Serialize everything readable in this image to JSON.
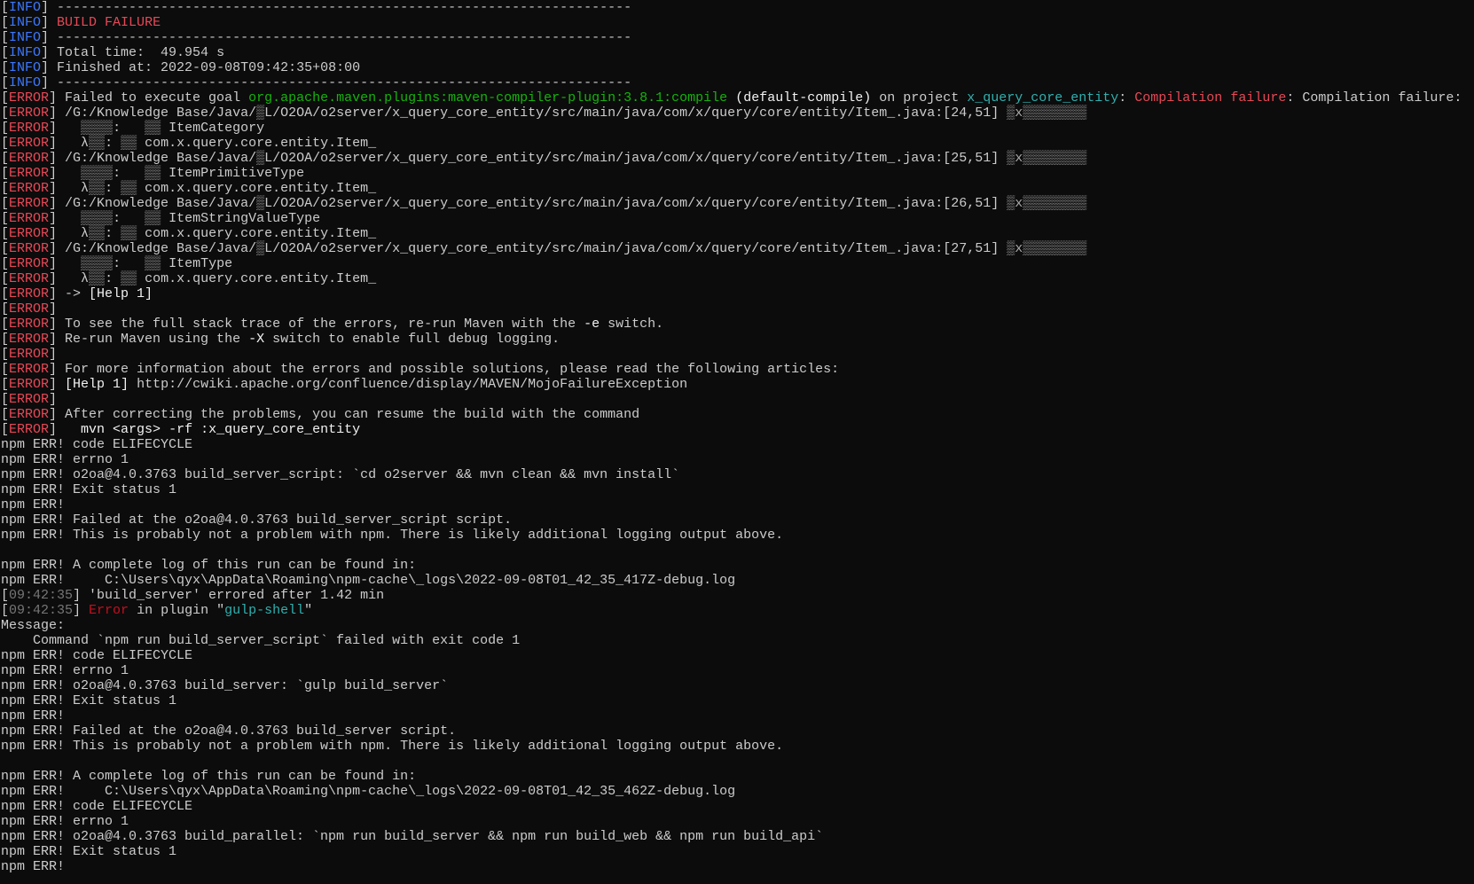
{
  "colors": {
    "background": "#0c0c0c",
    "text": "#cccccc",
    "info": "#3b78ff",
    "error": "#e74856",
    "green": "#16b30c",
    "cyan": "#2fb0b0",
    "timestamp": "#767676"
  },
  "lines": [
    {
      "segments": [
        {
          "t": "[",
          "c": "d"
        },
        {
          "t": "INFO",
          "c": "info"
        },
        {
          "t": "] ------------------------------------------------------------------------",
          "c": "d"
        }
      ]
    },
    {
      "segments": [
        {
          "t": "[",
          "c": "d"
        },
        {
          "t": "INFO",
          "c": "info"
        },
        {
          "t": "] ",
          "c": "d"
        },
        {
          "t": "BUILD FAILURE",
          "c": "red"
        }
      ]
    },
    {
      "segments": [
        {
          "t": "[",
          "c": "d"
        },
        {
          "t": "INFO",
          "c": "info"
        },
        {
          "t": "] ------------------------------------------------------------------------",
          "c": "d"
        }
      ]
    },
    {
      "segments": [
        {
          "t": "[",
          "c": "d"
        },
        {
          "t": "INFO",
          "c": "info"
        },
        {
          "t": "] Total time:  49.954 s",
          "c": "d"
        }
      ]
    },
    {
      "segments": [
        {
          "t": "[",
          "c": "d"
        },
        {
          "t": "INFO",
          "c": "info"
        },
        {
          "t": "] Finished at: 2022-09-08T09:42:35+08:00",
          "c": "d"
        }
      ]
    },
    {
      "segments": [
        {
          "t": "[",
          "c": "d"
        },
        {
          "t": "INFO",
          "c": "info"
        },
        {
          "t": "] ------------------------------------------------------------------------",
          "c": "d"
        }
      ]
    },
    {
      "segments": [
        {
          "t": "[",
          "c": "d"
        },
        {
          "t": "ERROR",
          "c": "err"
        },
        {
          "t": "] Failed to execute goal ",
          "c": "d"
        },
        {
          "t": "org.apache.maven.plugins:maven-compiler-plugin:3.8.1:compile",
          "c": "green"
        },
        {
          "t": " ",
          "c": "d"
        },
        {
          "t": "(default-compile)",
          "c": "white"
        },
        {
          "t": " on project ",
          "c": "d"
        },
        {
          "t": "x_query_core_entity",
          "c": "cyan"
        },
        {
          "t": ": ",
          "c": "d"
        },
        {
          "t": "Compilation failure",
          "c": "red"
        },
        {
          "t": ": Compilation failure:",
          "c": "d"
        }
      ]
    },
    {
      "segments": [
        {
          "t": "[",
          "c": "d"
        },
        {
          "t": "ERROR",
          "c": "err"
        },
        {
          "t": "] /G:/Knowledge Base/Java/",
          "c": "d"
        },
        {
          "t": "▒",
          "c": "garb"
        },
        {
          "t": "L/O2OA/o2server/x_query_core_entity/src/main/java/com/x/query/core/entity/Item_.java:[24,51] ",
          "c": "d"
        },
        {
          "t": "▒x▒▒▒▒▒▒▒▒",
          "c": "garb"
        }
      ]
    },
    {
      "segments": [
        {
          "t": "[",
          "c": "d"
        },
        {
          "t": "ERROR",
          "c": "err"
        },
        {
          "t": "]   ",
          "c": "d"
        },
        {
          "t": "▒▒▒▒",
          "c": "garb"
        },
        {
          "t": ":   ",
          "c": "d"
        },
        {
          "t": "▒▒",
          "c": "garb"
        },
        {
          "t": " ItemCategory",
          "c": "d"
        }
      ]
    },
    {
      "segments": [
        {
          "t": "[",
          "c": "d"
        },
        {
          "t": "ERROR",
          "c": "err"
        },
        {
          "t": "]   λ",
          "c": "d"
        },
        {
          "t": "▒▒",
          "c": "garb"
        },
        {
          "t": ": ",
          "c": "d"
        },
        {
          "t": "▒▒",
          "c": "garb"
        },
        {
          "t": " com.x.query.core.entity.Item_",
          "c": "d"
        }
      ]
    },
    {
      "segments": [
        {
          "t": "[",
          "c": "d"
        },
        {
          "t": "ERROR",
          "c": "err"
        },
        {
          "t": "] /G:/Knowledge Base/Java/",
          "c": "d"
        },
        {
          "t": "▒",
          "c": "garb"
        },
        {
          "t": "L/O2OA/o2server/x_query_core_entity/src/main/java/com/x/query/core/entity/Item_.java:[25,51] ",
          "c": "d"
        },
        {
          "t": "▒x▒▒▒▒▒▒▒▒",
          "c": "garb"
        }
      ]
    },
    {
      "segments": [
        {
          "t": "[",
          "c": "d"
        },
        {
          "t": "ERROR",
          "c": "err"
        },
        {
          "t": "]   ",
          "c": "d"
        },
        {
          "t": "▒▒▒▒",
          "c": "garb"
        },
        {
          "t": ":   ",
          "c": "d"
        },
        {
          "t": "▒▒",
          "c": "garb"
        },
        {
          "t": " ItemPrimitiveType",
          "c": "d"
        }
      ]
    },
    {
      "segments": [
        {
          "t": "[",
          "c": "d"
        },
        {
          "t": "ERROR",
          "c": "err"
        },
        {
          "t": "]   λ",
          "c": "d"
        },
        {
          "t": "▒▒",
          "c": "garb"
        },
        {
          "t": ": ",
          "c": "d"
        },
        {
          "t": "▒▒",
          "c": "garb"
        },
        {
          "t": " com.x.query.core.entity.Item_",
          "c": "d"
        }
      ]
    },
    {
      "segments": [
        {
          "t": "[",
          "c": "d"
        },
        {
          "t": "ERROR",
          "c": "err"
        },
        {
          "t": "] /G:/Knowledge Base/Java/",
          "c": "d"
        },
        {
          "t": "▒",
          "c": "garb"
        },
        {
          "t": "L/O2OA/o2server/x_query_core_entity/src/main/java/com/x/query/core/entity/Item_.java:[26,51] ",
          "c": "d"
        },
        {
          "t": "▒x▒▒▒▒▒▒▒▒",
          "c": "garb"
        }
      ]
    },
    {
      "segments": [
        {
          "t": "[",
          "c": "d"
        },
        {
          "t": "ERROR",
          "c": "err"
        },
        {
          "t": "]   ",
          "c": "d"
        },
        {
          "t": "▒▒▒▒",
          "c": "garb"
        },
        {
          "t": ":   ",
          "c": "d"
        },
        {
          "t": "▒▒",
          "c": "garb"
        },
        {
          "t": " ItemStringValueType",
          "c": "d"
        }
      ]
    },
    {
      "segments": [
        {
          "t": "[",
          "c": "d"
        },
        {
          "t": "ERROR",
          "c": "err"
        },
        {
          "t": "]   λ",
          "c": "d"
        },
        {
          "t": "▒▒",
          "c": "garb"
        },
        {
          "t": ": ",
          "c": "d"
        },
        {
          "t": "▒▒",
          "c": "garb"
        },
        {
          "t": " com.x.query.core.entity.Item_",
          "c": "d"
        }
      ]
    },
    {
      "segments": [
        {
          "t": "[",
          "c": "d"
        },
        {
          "t": "ERROR",
          "c": "err"
        },
        {
          "t": "] /G:/Knowledge Base/Java/",
          "c": "d"
        },
        {
          "t": "▒",
          "c": "garb"
        },
        {
          "t": "L/O2OA/o2server/x_query_core_entity/src/main/java/com/x/query/core/entity/Item_.java:[27,51] ",
          "c": "d"
        },
        {
          "t": "▒x▒▒▒▒▒▒▒▒",
          "c": "garb"
        }
      ]
    },
    {
      "segments": [
        {
          "t": "[",
          "c": "d"
        },
        {
          "t": "ERROR",
          "c": "err"
        },
        {
          "t": "]   ",
          "c": "d"
        },
        {
          "t": "▒▒▒▒",
          "c": "garb"
        },
        {
          "t": ":   ",
          "c": "d"
        },
        {
          "t": "▒▒",
          "c": "garb"
        },
        {
          "t": " ItemType",
          "c": "d"
        }
      ]
    },
    {
      "segments": [
        {
          "t": "[",
          "c": "d"
        },
        {
          "t": "ERROR",
          "c": "err"
        },
        {
          "t": "]   λ",
          "c": "d"
        },
        {
          "t": "▒▒",
          "c": "garb"
        },
        {
          "t": ": ",
          "c": "d"
        },
        {
          "t": "▒▒",
          "c": "garb"
        },
        {
          "t": " com.x.query.core.entity.Item_",
          "c": "d"
        }
      ]
    },
    {
      "segments": [
        {
          "t": "[",
          "c": "d"
        },
        {
          "t": "ERROR",
          "c": "err"
        },
        {
          "t": "] -> ",
          "c": "d"
        },
        {
          "t": "[Help 1]",
          "c": "white"
        }
      ]
    },
    {
      "segments": [
        {
          "t": "[",
          "c": "d"
        },
        {
          "t": "ERROR",
          "c": "err"
        },
        {
          "t": "]",
          "c": "d"
        }
      ]
    },
    {
      "segments": [
        {
          "t": "[",
          "c": "d"
        },
        {
          "t": "ERROR",
          "c": "err"
        },
        {
          "t": "] To see the full stack trace of the errors, re-run Maven with the ",
          "c": "d"
        },
        {
          "t": "-e",
          "c": "white"
        },
        {
          "t": " switch.",
          "c": "d"
        }
      ]
    },
    {
      "segments": [
        {
          "t": "[",
          "c": "d"
        },
        {
          "t": "ERROR",
          "c": "err"
        },
        {
          "t": "] Re-run Maven using the ",
          "c": "d"
        },
        {
          "t": "-X",
          "c": "white"
        },
        {
          "t": " switch to enable full debug logging.",
          "c": "d"
        }
      ]
    },
    {
      "segments": [
        {
          "t": "[",
          "c": "d"
        },
        {
          "t": "ERROR",
          "c": "err"
        },
        {
          "t": "]",
          "c": "d"
        }
      ]
    },
    {
      "segments": [
        {
          "t": "[",
          "c": "d"
        },
        {
          "t": "ERROR",
          "c": "err"
        },
        {
          "t": "] For more information about the errors and possible solutions, please read the following articles:",
          "c": "d"
        }
      ]
    },
    {
      "segments": [
        {
          "t": "[",
          "c": "d"
        },
        {
          "t": "ERROR",
          "c": "err"
        },
        {
          "t": "] ",
          "c": "d"
        },
        {
          "t": "[Help 1]",
          "c": "white"
        },
        {
          "t": " http://cwiki.apache.org/confluence/display/MAVEN/MojoFailureException",
          "c": "d"
        }
      ]
    },
    {
      "segments": [
        {
          "t": "[",
          "c": "d"
        },
        {
          "t": "ERROR",
          "c": "err"
        },
        {
          "t": "]",
          "c": "d"
        }
      ]
    },
    {
      "segments": [
        {
          "t": "[",
          "c": "d"
        },
        {
          "t": "ERROR",
          "c": "err"
        },
        {
          "t": "] After correcting the problems, you can resume the build with the command",
          "c": "d"
        }
      ]
    },
    {
      "segments": [
        {
          "t": "[",
          "c": "d"
        },
        {
          "t": "ERROR",
          "c": "err"
        },
        {
          "t": "]   ",
          "c": "d"
        },
        {
          "t": "mvn <args> -rf :x_query_core_entity",
          "c": "white"
        }
      ]
    },
    {
      "segments": [
        {
          "t": "npm ERR! code ELIFECYCLE",
          "c": "d"
        }
      ]
    },
    {
      "segments": [
        {
          "t": "npm ERR! errno 1",
          "c": "d"
        }
      ]
    },
    {
      "segments": [
        {
          "t": "npm ERR! o2oa@4.0.3763 build_server_script: `cd o2server && mvn clean && mvn install`",
          "c": "d"
        }
      ]
    },
    {
      "segments": [
        {
          "t": "npm ERR! Exit status 1",
          "c": "d"
        }
      ]
    },
    {
      "segments": [
        {
          "t": "npm ERR!",
          "c": "d"
        }
      ]
    },
    {
      "segments": [
        {
          "t": "npm ERR! Failed at the o2oa@4.0.3763 build_server_script script.",
          "c": "d"
        }
      ]
    },
    {
      "segments": [
        {
          "t": "npm ERR! This is probably not a problem with npm. There is likely additional logging output above.",
          "c": "d"
        }
      ]
    },
    {
      "segments": []
    },
    {
      "segments": [
        {
          "t": "npm ERR! A complete log of this run can be found in:",
          "c": "d"
        }
      ]
    },
    {
      "segments": [
        {
          "t": "npm ERR!     C:\\Users\\qyx\\AppData\\Roaming\\npm-cache\\_logs\\2022-09-08T01_42_35_417Z-debug.log",
          "c": "d"
        }
      ]
    },
    {
      "segments": [
        {
          "t": "[",
          "c": "d"
        },
        {
          "t": "09:42:35",
          "c": "ts"
        },
        {
          "t": "] 'build_server' errored after 1.42 min",
          "c": "d"
        }
      ]
    },
    {
      "segments": [
        {
          "t": "[",
          "c": "d"
        },
        {
          "t": "09:42:35",
          "c": "ts"
        },
        {
          "t": "] ",
          "c": "d"
        },
        {
          "t": "Error",
          "c": "dred"
        },
        {
          "t": " in plugin \"",
          "c": "d"
        },
        {
          "t": "gulp-shell",
          "c": "cyan"
        },
        {
          "t": "\"",
          "c": "d"
        }
      ]
    },
    {
      "segments": [
        {
          "t": "Message:",
          "c": "d"
        }
      ]
    },
    {
      "segments": [
        {
          "t": "    Command `npm run build_server_script` failed with exit code 1",
          "c": "d"
        }
      ]
    },
    {
      "segments": [
        {
          "t": "npm ERR! code ELIFECYCLE",
          "c": "d"
        }
      ]
    },
    {
      "segments": [
        {
          "t": "npm ERR! errno 1",
          "c": "d"
        }
      ]
    },
    {
      "segments": [
        {
          "t": "npm ERR! o2oa@4.0.3763 build_server: `gulp build_server`",
          "c": "d"
        }
      ]
    },
    {
      "segments": [
        {
          "t": "npm ERR! Exit status 1",
          "c": "d"
        }
      ]
    },
    {
      "segments": [
        {
          "t": "npm ERR!",
          "c": "d"
        }
      ]
    },
    {
      "segments": [
        {
          "t": "npm ERR! Failed at the o2oa@4.0.3763 build_server script.",
          "c": "d"
        }
      ]
    },
    {
      "segments": [
        {
          "t": "npm ERR! This is probably not a problem with npm. There is likely additional logging output above.",
          "c": "d"
        }
      ]
    },
    {
      "segments": []
    },
    {
      "segments": [
        {
          "t": "npm ERR! A complete log of this run can be found in:",
          "c": "d"
        }
      ]
    },
    {
      "segments": [
        {
          "t": "npm ERR!     C:\\Users\\qyx\\AppData\\Roaming\\npm-cache\\_logs\\2022-09-08T01_42_35_462Z-debug.log",
          "c": "d"
        }
      ]
    },
    {
      "segments": [
        {
          "t": "npm ERR! code ELIFECYCLE",
          "c": "d"
        }
      ]
    },
    {
      "segments": [
        {
          "t": "npm ERR! errno 1",
          "c": "d"
        }
      ]
    },
    {
      "segments": [
        {
          "t": "npm ERR! o2oa@4.0.3763 build_parallel: `npm run build_server && npm run build_web && npm run build_api`",
          "c": "d"
        }
      ]
    },
    {
      "segments": [
        {
          "t": "npm ERR! Exit status 1",
          "c": "d"
        }
      ]
    },
    {
      "segments": [
        {
          "t": "npm ERR!",
          "c": "d"
        }
      ]
    }
  ]
}
